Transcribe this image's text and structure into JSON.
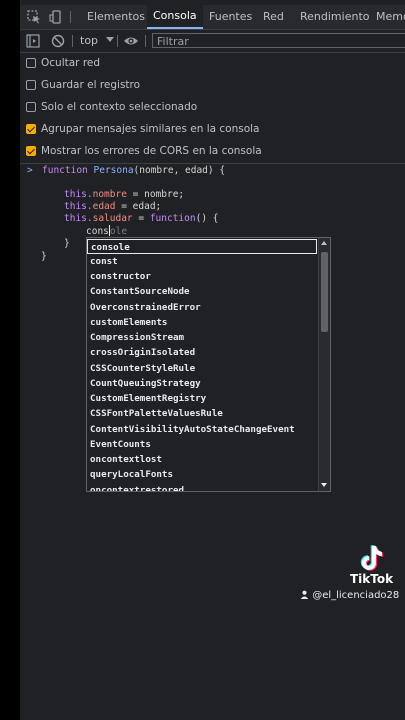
{
  "tabs": [
    "Elementos",
    "Consola",
    "Fuentes",
    "Red",
    "Rendimiento",
    "Memo"
  ],
  "toolbar": {
    "context": "top",
    "filter_placeholder": "Filtrar"
  },
  "settings": [
    {
      "label": "Ocultar red",
      "checked": false
    },
    {
      "label": "Guardar el registro",
      "checked": false
    },
    {
      "label": "Solo el contexto seleccionado",
      "checked": false
    },
    {
      "label": "Agrupar mensajes similares en la consola",
      "checked": true
    },
    {
      "label": "Mostrar los errores de CORS en la consola",
      "checked": true
    }
  ],
  "code": {
    "l1_kw": "function",
    "l1_name": "Persona",
    "l1_params": "(nombre, edad) {",
    "l2_this": "this",
    "l2_prop": ".nombre",
    "l2_rest": " = nombre;",
    "l3_this": "this",
    "l3_prop": ".edad",
    "l3_rest": " = edad;",
    "l4_this": "this",
    "l4_prop": ".saludar",
    "l4_eq": " = ",
    "l4_kw": "function",
    "l4_rest": "() {",
    "l5_typed": "cons",
    "l5_hint": "ole",
    "l6": "}",
    "l7": "}"
  },
  "autocomplete": [
    "console",
    "const",
    "constructor",
    "ConstantSourceNode",
    "OverconstrainedError",
    "customElements",
    "CompressionStream",
    "crossOriginIsolated",
    "CSSCounterStyleRule",
    "CountQueuingStrategy",
    "CustomElementRegistry",
    "CSSFontPaletteValuesRule",
    "ContentVisibilityAutoStateChangeEvent",
    "EventCounts",
    "oncontextlost",
    "queryLocalFonts",
    "oncontextrestored"
  ],
  "watermark": {
    "brand": "TikTok",
    "user": "@el_licenciado28"
  }
}
